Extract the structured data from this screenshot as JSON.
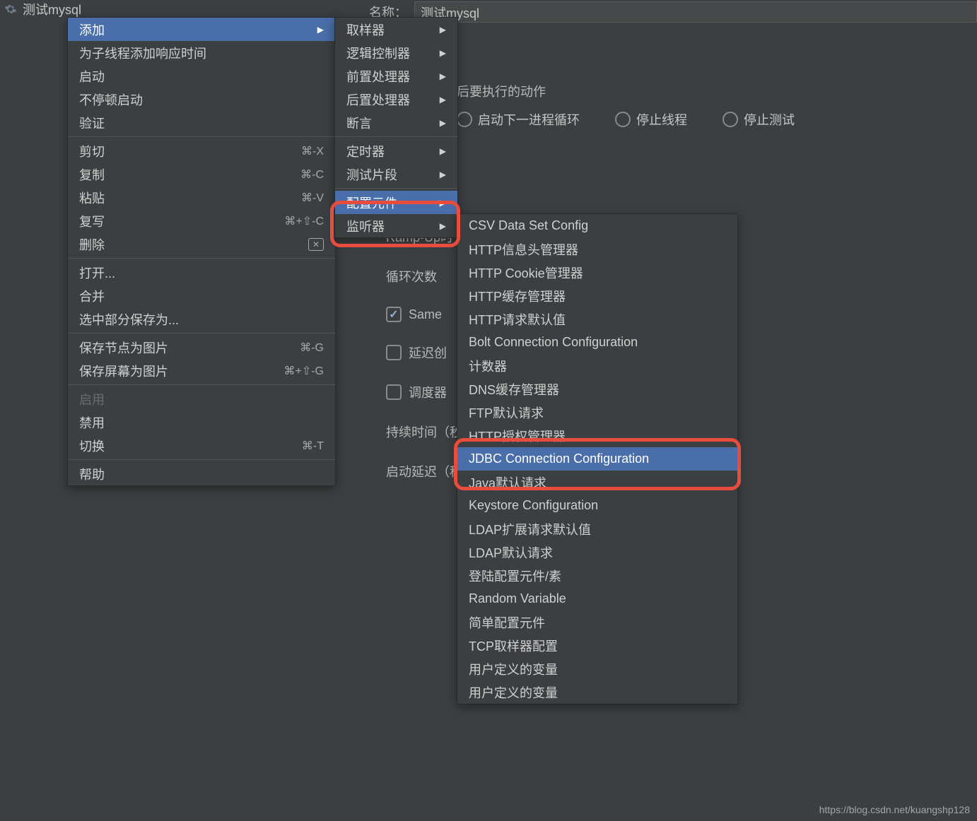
{
  "tree": {
    "root_label": "测试mysql"
  },
  "header": {
    "name_label": "名称：",
    "name_value": "测试mysql"
  },
  "section": {
    "title_suffix": "后要执行的动作",
    "radios": [
      "启动下一进程循环",
      "停止线程",
      "停止测试"
    ]
  },
  "form": {
    "rampup_label_frag": "Ramp-Up时",
    "loop_label": "循环次数",
    "same_cb": "Same",
    "delay_cb": "延迟创",
    "sched_cb": "调度器",
    "duration_label": "持续时间（秒",
    "startdelay_label": "启动延迟（秒"
  },
  "menu1": {
    "add": "添加",
    "addtime": "为子线程添加响应时间",
    "start": "启动",
    "nostop": "不停顿启动",
    "validate": "验证",
    "cut": {
      "label": "剪切",
      "sc": "⌘-X"
    },
    "copy": {
      "label": "复制",
      "sc": "⌘-C"
    },
    "paste": {
      "label": "粘贴",
      "sc": "⌘-V"
    },
    "overwrite": {
      "label": "复写",
      "sc": "⌘+⇧-C"
    },
    "delete": {
      "label": "删除",
      "sc": "⌦"
    },
    "open": "打开...",
    "merge": "合并",
    "savesel": "选中部分保存为...",
    "savenode": {
      "label": "保存节点为图片",
      "sc": "⌘-G"
    },
    "savescr": {
      "label": "保存屏幕为图片",
      "sc": "⌘+⇧-G"
    },
    "enable": "启用",
    "disable": "禁用",
    "toggle": {
      "label": "切换",
      "sc": "⌘-T"
    },
    "help": "帮助"
  },
  "menu2": {
    "items": [
      "取样器",
      "逻辑控制器",
      "前置处理器",
      "后置处理器",
      "断言",
      "定时器",
      "测试片段",
      "配置元件",
      "监听器"
    ]
  },
  "menu3": {
    "items": [
      "CSV Data Set Config",
      "HTTP信息头管理器",
      "HTTP Cookie管理器",
      "HTTP缓存管理器",
      "HTTP请求默认值",
      "Bolt Connection Configuration",
      "计数器",
      "DNS缓存管理器",
      "FTP默认请求",
      "HTTP授权管理器",
      "JDBC Connection Configuration",
      "Java默认请求",
      "Keystore Configuration",
      "LDAP扩展请求默认值",
      "LDAP默认请求",
      "登陆配置元件/素",
      "Random Variable",
      "简单配置元件",
      "TCP取样器配置",
      "用户定义的变量",
      "用户定义的变量"
    ],
    "highlighted_index": 10
  },
  "watermark": "https://blog.csdn.net/kuangshp128"
}
